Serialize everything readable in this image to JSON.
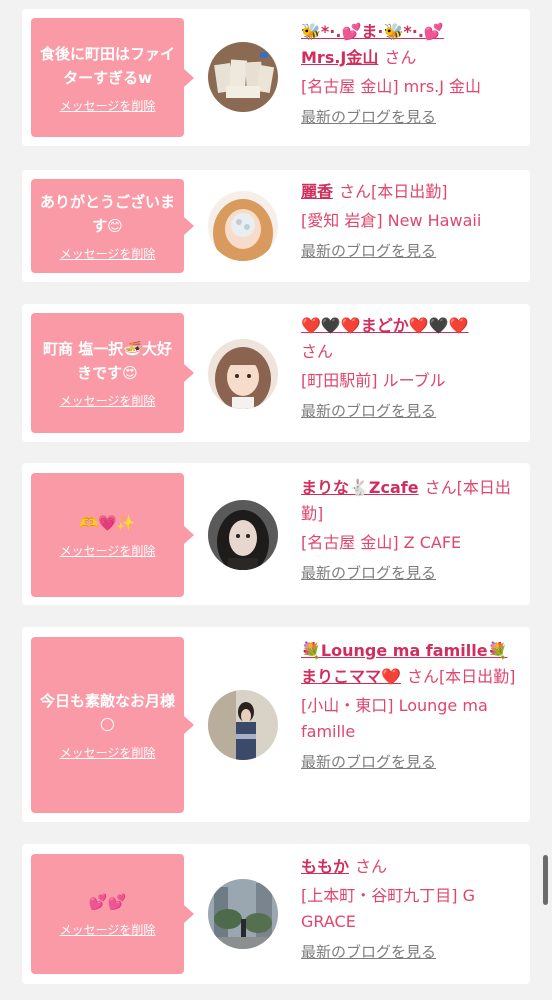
{
  "items": [
    {
      "message": "食後に町田はファイターすぎるw",
      "delete_label": "メッセージを削除",
      "name": "🐝💕ま🐝💕Mrs.J金山",
      "name_line1": "🐝*·.💕ま·🐝*·.💕",
      "name_line2": "Mrs.J金山",
      "honorific": "さん",
      "shop": "[名古屋 金山] mrs.J 金山",
      "blog_label": "最新のブログを見る"
    },
    {
      "message": "ありがとうございます😊",
      "delete_label": "メッセージを削除",
      "name": "麗香",
      "honorific": "さん[本日出勤]",
      "shop": "[愛知 岩倉] New Hawaii",
      "blog_label": "最新のブログを見る"
    },
    {
      "message": "町商 塩一択🍜大好きです😍",
      "delete_label": "メッセージを削除",
      "name": "❤️🖤❤️まどか❤️🖤❤️",
      "honorific": "さん",
      "shop": "[町田駅前] ルーブル",
      "blog_label": "最新のブログを見る"
    },
    {
      "message": "🫶💗✨",
      "delete_label": "メッセージを削除",
      "name": "まりな🐇Zcafe",
      "honorific": "さん[本日出勤]",
      "shop": "[名古屋 金山] Z CAFE",
      "blog_label": "最新のブログを見る"
    },
    {
      "message": "今日も素敵なお月様🌕",
      "delete_label": "メッセージを削除",
      "name": "💐Lounge ma famille💐まりこママ❤️",
      "name_line1": "💐Lounge ma famille💐",
      "name_line2": "まりこママ❤️",
      "honorific": "さん[本日出勤]",
      "shop": "[小山・東口] Lounge ma famille",
      "blog_label": "最新のブログを見る"
    },
    {
      "message": "💕💕",
      "delete_label": "メッセージを削除",
      "name": "ももか",
      "honorific": "さん",
      "shop": "[上本町・谷町九丁目] G GRACE",
      "blog_label": "最新のブログを見る"
    }
  ],
  "colors": {
    "bubble": "#f99aa6",
    "name": "#d02f5d",
    "text": "#e0466d",
    "link": "#7d7d7d",
    "background": "#f2f2f2"
  }
}
